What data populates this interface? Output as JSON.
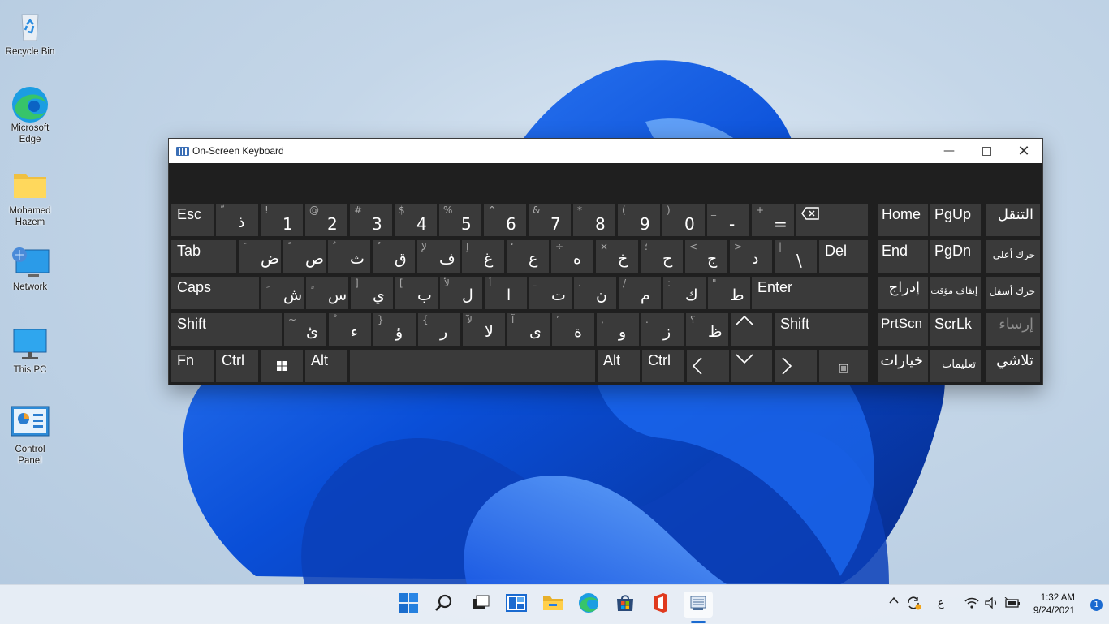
{
  "desktop": {
    "icons": [
      {
        "label": "Recycle Bin",
        "icon": "recycle-bin-icon"
      },
      {
        "label": "Microsoft Edge",
        "icon": "edge-icon"
      },
      {
        "label": "Mohamed Hazem",
        "icon": "folder-icon"
      },
      {
        "label": "Network",
        "icon": "network-icon"
      },
      {
        "label": "This PC",
        "icon": "monitor-icon"
      },
      {
        "label": "Control Panel",
        "icon": "control-panel-icon"
      }
    ]
  },
  "osk": {
    "title": "On-Screen Keyboard",
    "keys": {
      "esc": "Esc",
      "tab": "Tab",
      "caps": "Caps",
      "shift": "Shift",
      "fn": "Fn",
      "ctrl": "Ctrl",
      "alt": "Alt",
      "enter": "Enter",
      "del": "Del",
      "home": "Home",
      "pgup": "PgUp",
      "end": "End",
      "pgdn": "PgDn",
      "prtscn": "PrtScn",
      "scrlk": "ScrLk",
      "nav": "التنقل",
      "move_up": "حرك أعلى",
      "insert": "إدراج",
      "pause": "إيقاف مؤقت",
      "move_down": "حرك أسفل",
      "dock": "إرساء",
      "options": "خيارات",
      "help": "تعليمات",
      "fade": "تلاشي"
    },
    "row1": [
      {
        "up": "ّ",
        "main": "ذ"
      },
      {
        "up": "!",
        "main": "1"
      },
      {
        "up": "@",
        "main": "2"
      },
      {
        "up": "#",
        "main": "3"
      },
      {
        "up": "$",
        "main": "4"
      },
      {
        "up": "%",
        "main": "5"
      },
      {
        "up": "^",
        "main": "6"
      },
      {
        "up": "&",
        "main": "7"
      },
      {
        "up": "*",
        "main": "8"
      },
      {
        "up": "(",
        "main": "9"
      },
      {
        "up": ")",
        "main": "0"
      },
      {
        "up": "_",
        "main": "-"
      },
      {
        "up": "+",
        "main": "="
      }
    ],
    "row2": [
      {
        "up": "َ",
        "main": "ض"
      },
      {
        "up": "ً",
        "main": "ص"
      },
      {
        "up": "ُ",
        "main": "ث"
      },
      {
        "up": "ٌ",
        "main": "ق"
      },
      {
        "up": "لإ",
        "main": "ف"
      },
      {
        "up": "إ",
        "main": "غ"
      },
      {
        "up": "‘",
        "main": "ع"
      },
      {
        "up": "÷",
        "main": "ه"
      },
      {
        "up": "×",
        "main": "خ"
      },
      {
        "up": "؛",
        "main": "ح"
      },
      {
        "up": "<",
        "main": "ج"
      },
      {
        "up": ">",
        "main": "د"
      },
      {
        "up": "|",
        "main": "\\"
      }
    ],
    "row3": [
      {
        "up": "ِ",
        "main": "ش"
      },
      {
        "up": "ٍ",
        "main": "س"
      },
      {
        "up": "]",
        "main": "ي"
      },
      {
        "up": "[",
        "main": "ب"
      },
      {
        "up": "لأ",
        "main": "ل"
      },
      {
        "up": "أ",
        "main": "ا"
      },
      {
        "up": "ـ",
        "main": "ت"
      },
      {
        "up": "،",
        "main": "ن"
      },
      {
        "up": "/",
        "main": "م"
      },
      {
        "up": ":",
        "main": "ك"
      },
      {
        "up": "\"",
        "main": "ط"
      }
    ],
    "row4": [
      {
        "up": "~",
        "main": "ئ"
      },
      {
        "up": "ْ",
        "main": "ء"
      },
      {
        "up": "}",
        "main": "ؤ"
      },
      {
        "up": "{",
        "main": "ر"
      },
      {
        "up": "لآ",
        "main": "لا"
      },
      {
        "up": "آ",
        "main": "ى"
      },
      {
        "up": "’",
        "main": "ة"
      },
      {
        "up": ",",
        "main": "و"
      },
      {
        "up": ".",
        "main": "ز"
      },
      {
        "up": "؟",
        "main": "ظ"
      }
    ]
  },
  "taskbar": {
    "apps": [
      "windows-start-icon",
      "search-icon",
      "task-view-icon",
      "widgets-icon",
      "file-explorer-icon",
      "edge-icon",
      "store-icon",
      "office-icon",
      "osk-icon"
    ],
    "language": "ع",
    "time": "1:32 AM",
    "date": "9/24/2021",
    "notifications": "1"
  }
}
